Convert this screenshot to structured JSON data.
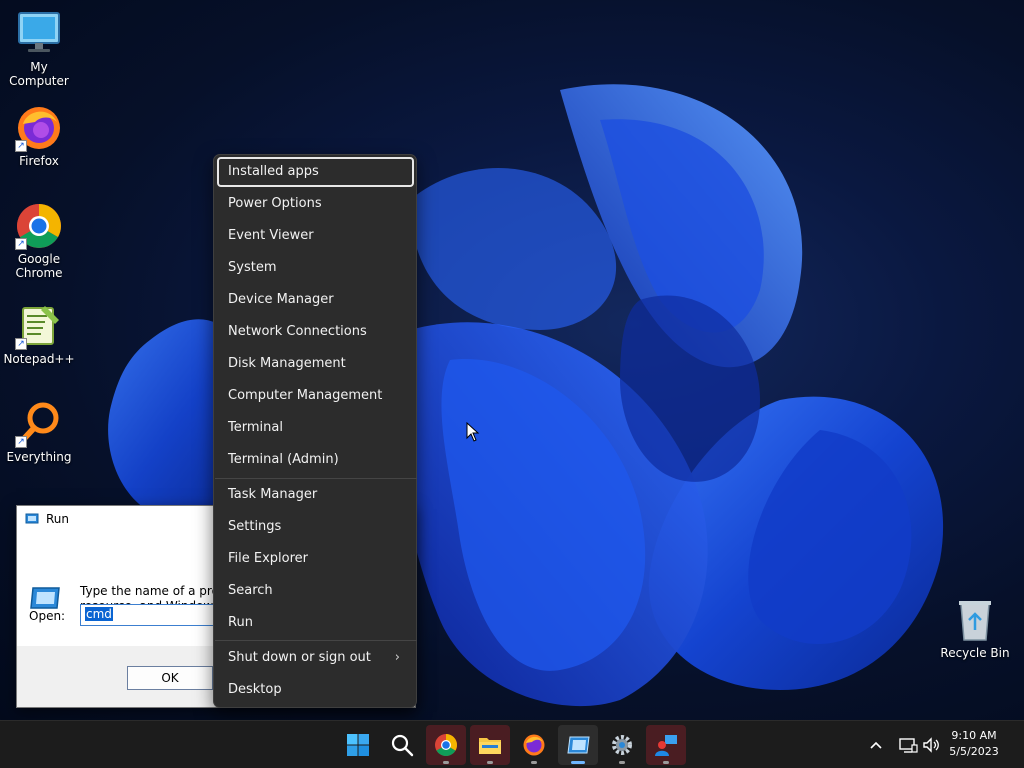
{
  "desktop": {
    "icons": [
      {
        "label": "My Computer",
        "icon": "monitor-icon"
      },
      {
        "label": "Firefox",
        "icon": "firefox-icon"
      },
      {
        "label": "Google Chrome",
        "icon": "chrome-icon"
      },
      {
        "label": "Notepad++",
        "icon": "notepadpp-icon"
      },
      {
        "label": "Everything",
        "icon": "everything-search-icon"
      },
      {
        "label": "Recycle Bin",
        "icon": "recycle-bin-icon"
      }
    ]
  },
  "run_dialog": {
    "title": "Run",
    "description_line1": "Type the name of a progra",
    "description_line2": "resource, and Windows w",
    "open_label": "Open:",
    "input_value": "cmd",
    "ok_label": "OK"
  },
  "winx_menu": {
    "items": [
      {
        "label": "Installed apps",
        "selected": true
      },
      {
        "label": "Power Options"
      },
      {
        "label": "Event Viewer"
      },
      {
        "label": "System"
      },
      {
        "label": "Device Manager"
      },
      {
        "label": "Network Connections"
      },
      {
        "label": "Disk Management"
      },
      {
        "label": "Computer Management"
      },
      {
        "label": "Terminal"
      },
      {
        "label": "Terminal (Admin)"
      },
      {
        "label": "Task Manager"
      },
      {
        "label": "Settings"
      },
      {
        "label": "File Explorer"
      },
      {
        "label": "Search"
      },
      {
        "label": "Run"
      },
      {
        "label": "Shut down or sign out",
        "submenu": true
      },
      {
        "label": "Desktop"
      }
    ],
    "submenu_arrow": "›"
  },
  "taskbar": {
    "apps": [
      {
        "name": "start-button",
        "icon": "windows-logo-icon"
      },
      {
        "name": "search-button",
        "icon": "search-icon"
      },
      {
        "name": "chrome-taskbar",
        "icon": "chrome-icon",
        "state": "active"
      },
      {
        "name": "file-explorer-taskbar",
        "icon": "folder-icon",
        "state": "active"
      },
      {
        "name": "firefox-taskbar",
        "icon": "firefox-icon"
      },
      {
        "name": "run-taskbar",
        "icon": "run-icon",
        "state": "running"
      },
      {
        "name": "settings-taskbar",
        "icon": "gear-icon"
      },
      {
        "name": "remote-app-taskbar",
        "icon": "remote-user-icon",
        "state": "active"
      }
    ],
    "clock_time": "9:10 AM",
    "clock_date": "5/5/2023"
  },
  "colors": {
    "accent": "#0a64d2",
    "menu_bg": "#2c2c2c",
    "taskbar_bg": "#1c1c1c"
  }
}
